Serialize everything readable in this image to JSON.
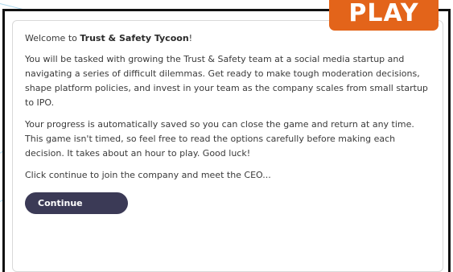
{
  "badge": {
    "label": "PLAY"
  },
  "dialog": {
    "welcome_prefix": "Welcome to ",
    "game_name": "Trust & Safety Tycoon",
    "welcome_suffix": "!",
    "paragraph_1": "You will be tasked with growing the Trust & Safety team at a social media startup and navigating a series of difficult dilemmas. Get ready to make tough moderation decisions, shape platform policies, and invest in your team as the company scales from small startup to IPO.",
    "paragraph_2": "Your progress is automatically saved so you can close the game and return at any time. This game isn't timed, so feel free to read the options carefully before making each decision. It takes about an hour to play. Good luck!",
    "paragraph_3": "Click continue to join the company and meet the CEO...",
    "continue_label": "Continue"
  },
  "colors": {
    "badge_bg": "#e3641a",
    "button_bg": "#3b3a56",
    "frame_border": "#111111",
    "deco_line": "#a9d6ec"
  }
}
